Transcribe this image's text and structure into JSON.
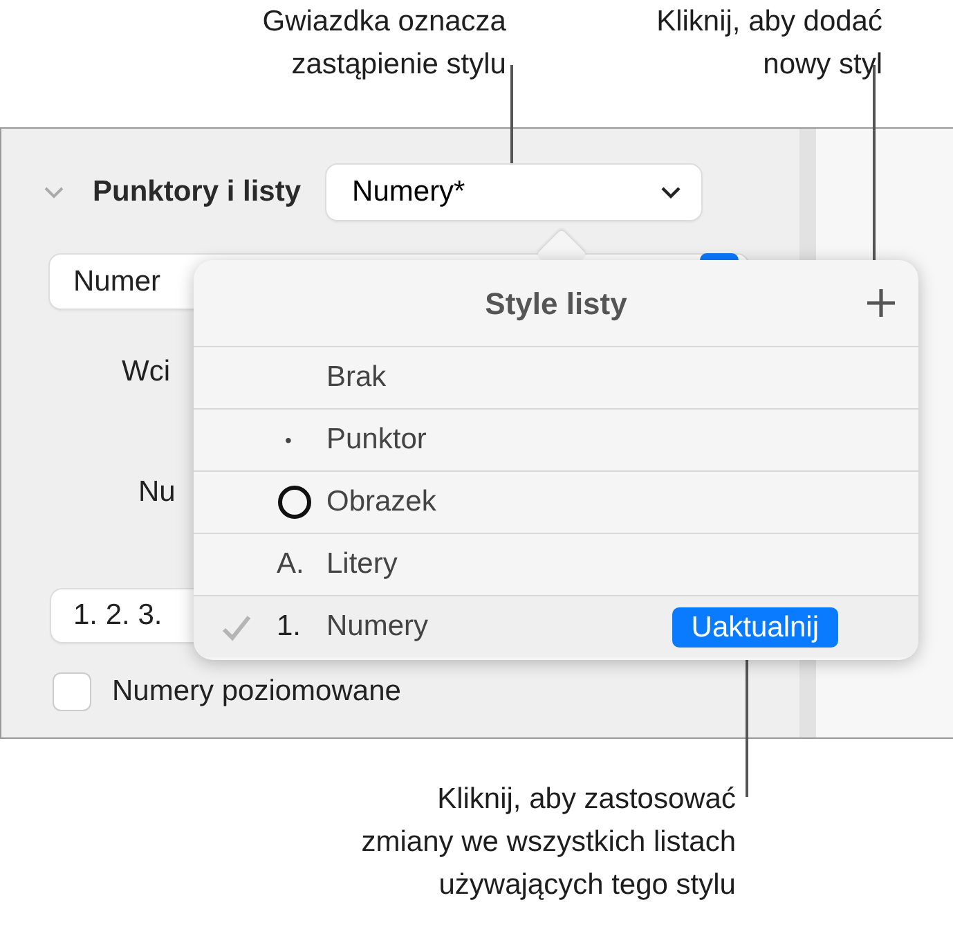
{
  "callouts": [
    {
      "text": "Gwiazdka oznacza\nzastąpienie stylu"
    },
    {
      "text": "Kliknij, aby dodać\nnowy styl"
    },
    {
      "text": "Kliknij, aby zastosować\nzmiany we wszystkich listach\nużywających tego stylu"
    }
  ],
  "inspector": {
    "section": {
      "title": "Punktory i listy",
      "expanded": true
    },
    "style_popup": {
      "value": "Numery*"
    },
    "list_type_field": {
      "value": "Numer"
    },
    "labels": [
      "Wci",
      "Nu"
    ],
    "format_field": {
      "value": "1. 2. 3."
    },
    "tiered_checkbox": {
      "label": "Numery poziomowane",
      "checked": false
    }
  },
  "popover": {
    "title": "Style listy",
    "items": [
      {
        "kind": "none",
        "label": "Brak",
        "selected": false
      },
      {
        "kind": "bullet",
        "marker": "•",
        "label": "Punktor",
        "selected": false
      },
      {
        "kind": "image",
        "label": "Obrazek",
        "selected": false
      },
      {
        "kind": "text",
        "marker": "A.",
        "label": "Litery",
        "selected": false
      },
      {
        "kind": "text",
        "marker": "1.",
        "label": "Numery",
        "selected": true,
        "update_button": "Uaktualnij"
      }
    ]
  }
}
